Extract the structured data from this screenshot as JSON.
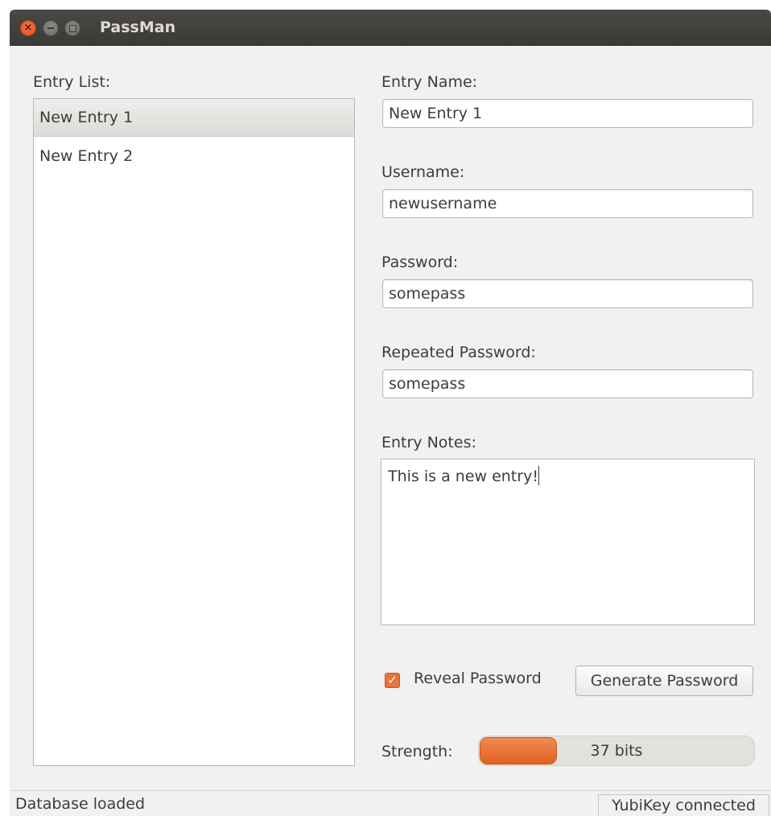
{
  "window": {
    "title": "PassMan",
    "close_glyph": "×"
  },
  "entry_list": {
    "label": "Entry List:",
    "items": [
      {
        "label": "New Entry 1",
        "selected": true
      },
      {
        "label": "New Entry 2",
        "selected": false
      }
    ]
  },
  "form": {
    "entry_name": {
      "label": "Entry Name:",
      "value": "New Entry 1"
    },
    "username": {
      "label": "Username:",
      "value": "newusername"
    },
    "password": {
      "label": "Password:",
      "value": "somepass"
    },
    "repeated_password": {
      "label": "Repeated Password:",
      "value": "somepass"
    },
    "notes": {
      "label": "Entry Notes:",
      "value": "This is a new entry!"
    }
  },
  "controls": {
    "reveal_password": {
      "label": "Reveal Password",
      "checked": true,
      "check_glyph": "✓"
    },
    "generate_password_label": "Generate Password"
  },
  "strength": {
    "label": "Strength:",
    "text": "37 bits",
    "fraction": 0.28
  },
  "status": {
    "left": "Database loaded",
    "right": "YubiKey connected"
  },
  "colors": {
    "accent": "#e8743b",
    "titlebar": "#3c3b37"
  }
}
